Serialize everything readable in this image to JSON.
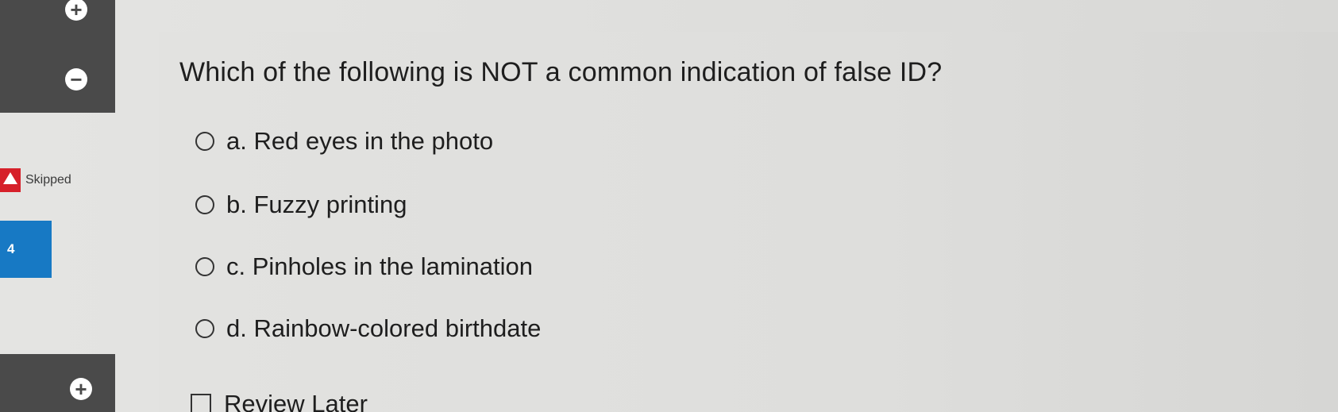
{
  "nav": {
    "expand_icon_top": "+",
    "collapse_icon": "−",
    "expand_icon_bottom": "+"
  },
  "status": {
    "skipped_label": "Skipped",
    "question_number": "4"
  },
  "question": {
    "text": "Which of the following is NOT a common indication of false ID?",
    "options": [
      {
        "label": "a. Red eyes in the photo"
      },
      {
        "label": "b. Fuzzy printing"
      },
      {
        "label": "c. Pinholes in the lamination"
      },
      {
        "label": "d. Rainbow-colored birthdate"
      }
    ]
  },
  "review": {
    "label": "Review Later"
  },
  "colors": {
    "nav_dark": "#4a4a4a",
    "question_number_bg": "#1779c4",
    "skipped_flag": "#d6202a"
  }
}
